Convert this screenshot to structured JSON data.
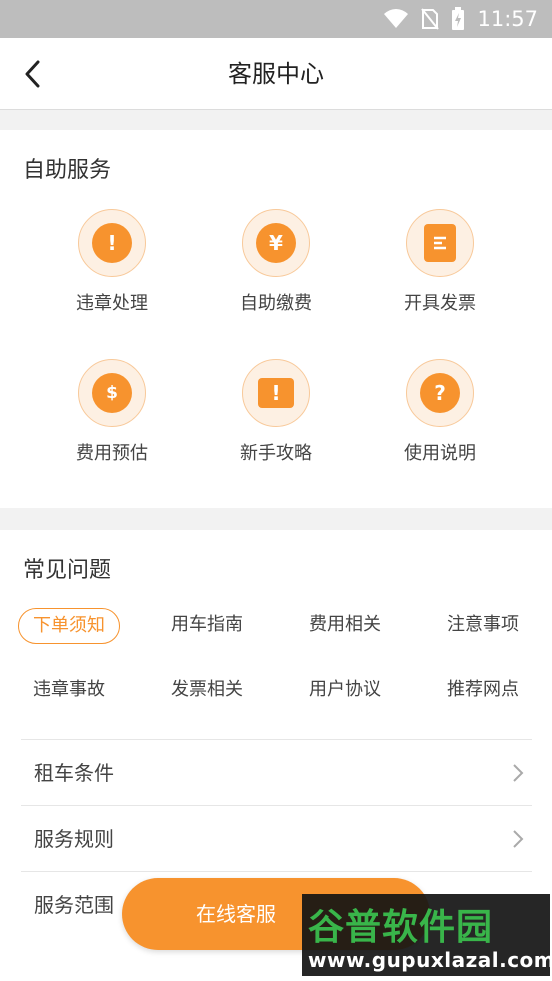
{
  "status_bar": {
    "time": "11:57",
    "icons": [
      "wifi-icon",
      "no-sim-icon",
      "battery-charging-icon"
    ]
  },
  "header": {
    "title": "客服中心",
    "back_icon": "chevron-left-icon"
  },
  "self_service": {
    "title": "自助服务",
    "items": [
      {
        "label": "违章处理",
        "icon": "alert-icon",
        "glyph": "!"
      },
      {
        "label": "自助缴费",
        "icon": "yuan-icon",
        "glyph": "¥"
      },
      {
        "label": "开具发票",
        "icon": "invoice-icon",
        "glyph": "☰"
      },
      {
        "label": "费用预估",
        "icon": "dollar-icon",
        "glyph": "$"
      },
      {
        "label": "新手攻略",
        "icon": "book-icon",
        "glyph": "!"
      },
      {
        "label": "使用说明",
        "icon": "question-chat-icon",
        "glyph": "?"
      }
    ]
  },
  "faq": {
    "title": "常见问题",
    "tags": [
      {
        "label": "下单须知",
        "active": true
      },
      {
        "label": "用车指南"
      },
      {
        "label": "费用相关"
      },
      {
        "label": "注意事项"
      },
      {
        "label": "违章事故"
      },
      {
        "label": "发票相关"
      },
      {
        "label": "用户协议"
      },
      {
        "label": "推荐网点"
      }
    ],
    "rows": [
      {
        "label": "租车条件"
      },
      {
        "label": "服务规则"
      },
      {
        "label": "服务范围"
      }
    ]
  },
  "online_service_button": {
    "label": "在线客服"
  },
  "watermark": {
    "logo_text": "谷普软件园",
    "url": "www.gupuxlazal.com"
  },
  "colors": {
    "accent": "#f7932e",
    "accent_light": "#fdf0e3",
    "background": "#f2f2f2"
  }
}
